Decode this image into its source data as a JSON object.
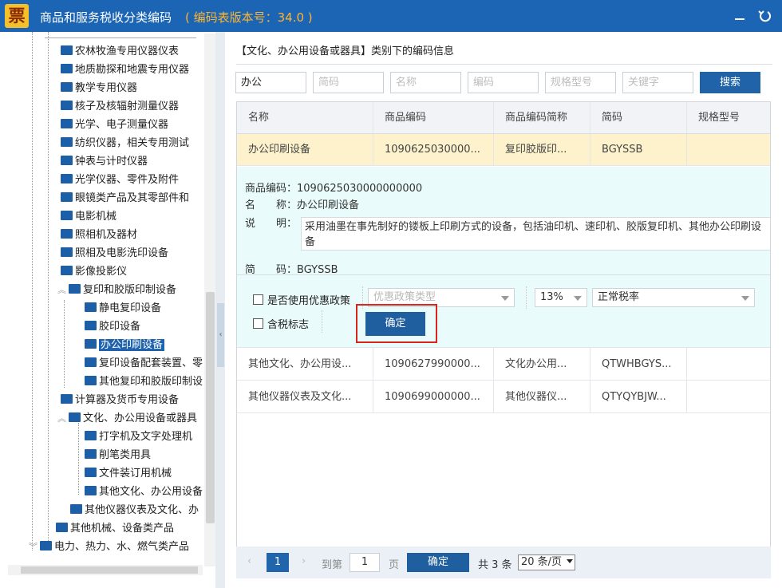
{
  "app": {
    "logo": "票",
    "title": "商品和服务税收分类编码",
    "version": "( 编码表版本号：34.0 )"
  },
  "tree": {
    "items": [
      {
        "label": "农林牧渔专用仪器仪表"
      },
      {
        "label": "地质勘探和地震专用仪器"
      },
      {
        "label": "教学专用仪器"
      },
      {
        "label": "核子及核辐射测量仪器"
      },
      {
        "label": "光学、电子测量仪器"
      },
      {
        "label": "纺织仪器，相关专用测试"
      },
      {
        "label": "钟表与计时仪器"
      },
      {
        "label": "光学仪器、零件及附件"
      },
      {
        "label": "眼镜类产品及其零部件和"
      },
      {
        "label": "电影机械"
      },
      {
        "label": "照相机及器材"
      },
      {
        "label": "照相及电影洗印设备"
      },
      {
        "label": "影像投影仪"
      },
      {
        "label": "复印和胶版印制设备"
      },
      {
        "label": "静电复印设备"
      },
      {
        "label": "胶印设备"
      },
      {
        "label": "办公印刷设备"
      },
      {
        "label": "复印设备配套装置、零"
      },
      {
        "label": "其他复印和胶版印制设"
      },
      {
        "label": "计算器及货币专用设备"
      },
      {
        "label": "文化、办公用设备或器具"
      },
      {
        "label": "打字机及文字处理机"
      },
      {
        "label": "削笔类用具"
      },
      {
        "label": "文件装订用机械"
      },
      {
        "label": "其他文化、办公用设备"
      },
      {
        "label": "其他仪器仪表及文化、办"
      },
      {
        "label": "其他机械、设备类产品"
      },
      {
        "label": "电力、热力、水、燃气类产品"
      }
    ]
  },
  "right": {
    "section_title": "【文化、办公用设备或器具】类别下的编码信息",
    "filters": {
      "name_value": "办公",
      "jianma": "简码",
      "mingcheng": "名称",
      "bianma": "编码",
      "guige": "规格型号",
      "keyword": "关键字"
    },
    "search_label": "搜索",
    "columns": [
      "名称",
      "商品编码",
      "商品编码简称",
      "简码",
      "规格型号"
    ],
    "rows": [
      {
        "name": "办公印刷设备",
        "code": "1090625030000...",
        "short": "复印胶版印...",
        "jianma": "BGYSSB",
        "spec": ""
      },
      {
        "name": "其他文化、办公用设...",
        "code": "1090627990000...",
        "short": "文化办公用...",
        "jianma": "QTWHBGYS...",
        "spec": ""
      },
      {
        "name": "其他仪器仪表及文化...",
        "code": "1090699000000...",
        "short": "其他仪器仪...",
        "jianma": "QTYQYBJW...",
        "spec": ""
      }
    ],
    "detail": {
      "code_label": "商品编码：",
      "code_value": "1090625030000000000",
      "name_label": "名　　称：",
      "name_value": "办公印刷设备",
      "desc_label": "说　　明：",
      "desc_value": "采用油墨在事先制好的镂板上印刷方式的设备，包括油印机、速印机、胶版复印机、其他办公印刷设备",
      "jianma_label": "简　　码：",
      "jianma_value": "BGYSSB",
      "use_policy_label": "是否使用优惠政策",
      "policy_type_placeholder": "优惠政策类型",
      "tax_rate": "13%",
      "tax_type": "正常税率",
      "tax_included_label": "含税标志",
      "confirm_label": "确定"
    },
    "pager": {
      "goto_prefix": "到第",
      "page_input": "1",
      "page_suffix": "页",
      "current_page": "1",
      "confirm_label": "确定",
      "total": "共 3 条",
      "page_size": "20 条/页"
    }
  }
}
